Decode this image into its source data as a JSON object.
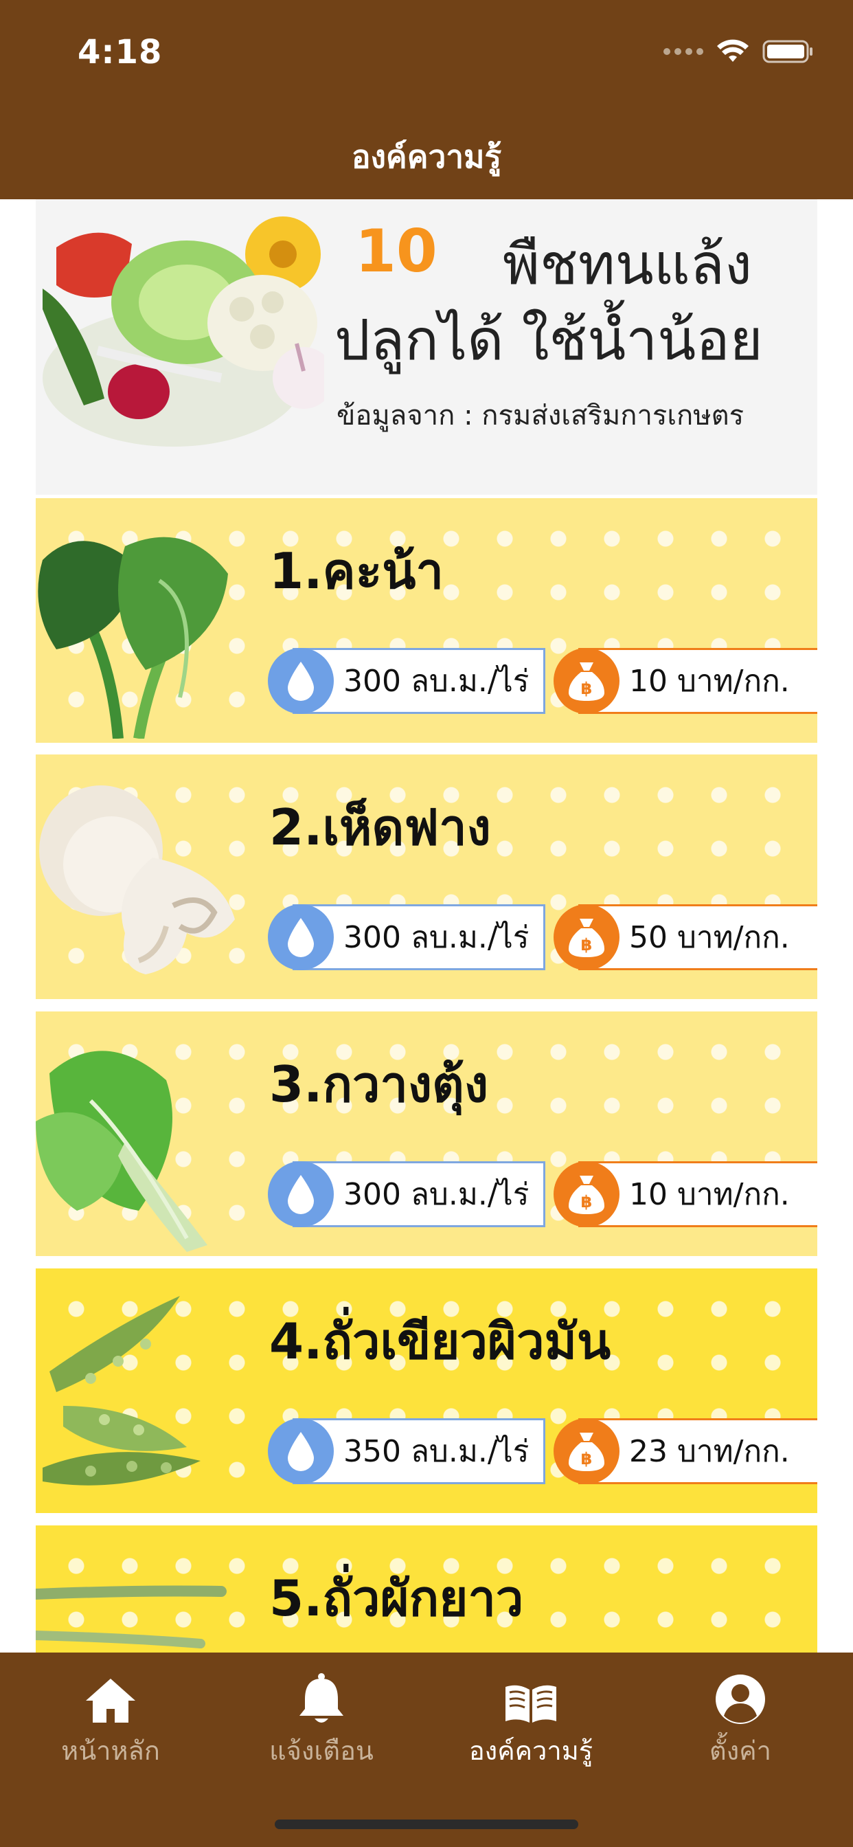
{
  "status_bar": {
    "time": "4:18"
  },
  "header": {
    "title": "องค์ความรู้"
  },
  "hero": {
    "number": "10",
    "title_line1": "พืชทนแล้ง",
    "title_line2": "ปลูกได้ ใช้น้ำน้อย",
    "source": "ข้อมูลจาก : กรมส่งเสริมการเกษตร"
  },
  "items": [
    {
      "title": "1.คะน้า",
      "water": "300 ลบ.ม./ไร่",
      "price": "10 บาท/กก."
    },
    {
      "title": "2.เห็ดฟาง",
      "water": "300 ลบ.ม./ไร่",
      "price": "50 บาท/กก."
    },
    {
      "title": "3.กวางตุ้ง",
      "water": "300 ลบ.ม./ไร่",
      "price": "10 บาท/กก."
    },
    {
      "title": "4.ถั่วเขียวผิวมัน",
      "water": "350 ลบ.ม./ไร่",
      "price": "23 บาท/กก."
    },
    {
      "title": "5.ถั่วผักยาว"
    }
  ],
  "tabs": [
    {
      "label": "หน้าหลัก",
      "icon": "home-icon"
    },
    {
      "label": "แจ้งเตือน",
      "icon": "bell-icon"
    },
    {
      "label": "องค์ความรู้",
      "icon": "book-icon",
      "active": true
    },
    {
      "label": "ตั้งค่า",
      "icon": "user-icon"
    }
  ],
  "colors": {
    "header": "#714217",
    "accent": "#f7941d",
    "water": "#6ea0e6",
    "price": "#f07d1a"
  }
}
